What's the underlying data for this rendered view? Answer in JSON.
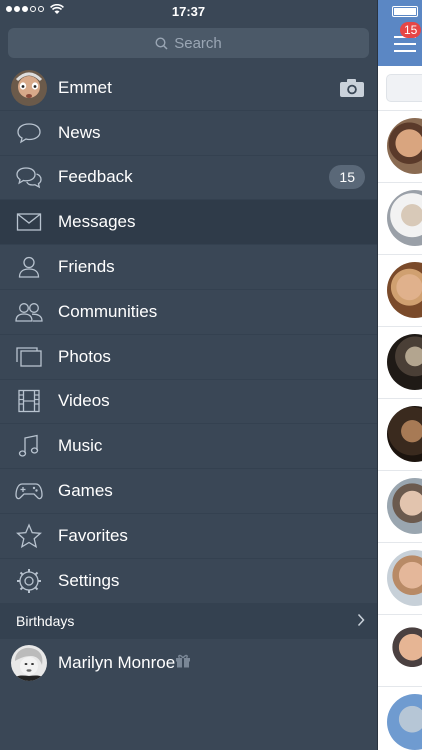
{
  "status": {
    "time": "17:37"
  },
  "search": {
    "placeholder": "Search"
  },
  "profile": {
    "name": "Emmet"
  },
  "menu": [
    {
      "label": "News",
      "icon": "news-icon"
    },
    {
      "label": "Feedback",
      "icon": "feedback-icon",
      "badge": "15"
    },
    {
      "label": "Messages",
      "icon": "messages-icon",
      "active": true
    },
    {
      "label": "Friends",
      "icon": "friends-icon"
    },
    {
      "label": "Communities",
      "icon": "communities-icon"
    },
    {
      "label": "Photos",
      "icon": "photos-icon"
    },
    {
      "label": "Videos",
      "icon": "videos-icon"
    },
    {
      "label": "Music",
      "icon": "music-icon"
    },
    {
      "label": "Games",
      "icon": "games-icon"
    },
    {
      "label": "Favorites",
      "icon": "favorites-icon"
    },
    {
      "label": "Settings",
      "icon": "settings-icon"
    }
  ],
  "birthdays": {
    "title": "Birthdays",
    "person": "Marilyn Monroe"
  },
  "peek": {
    "badge": "15"
  },
  "colors": {
    "sidebar": "#3a4756",
    "active_row": "#2f3b49",
    "header": "#5b87c4",
    "badge": "#e64646"
  }
}
